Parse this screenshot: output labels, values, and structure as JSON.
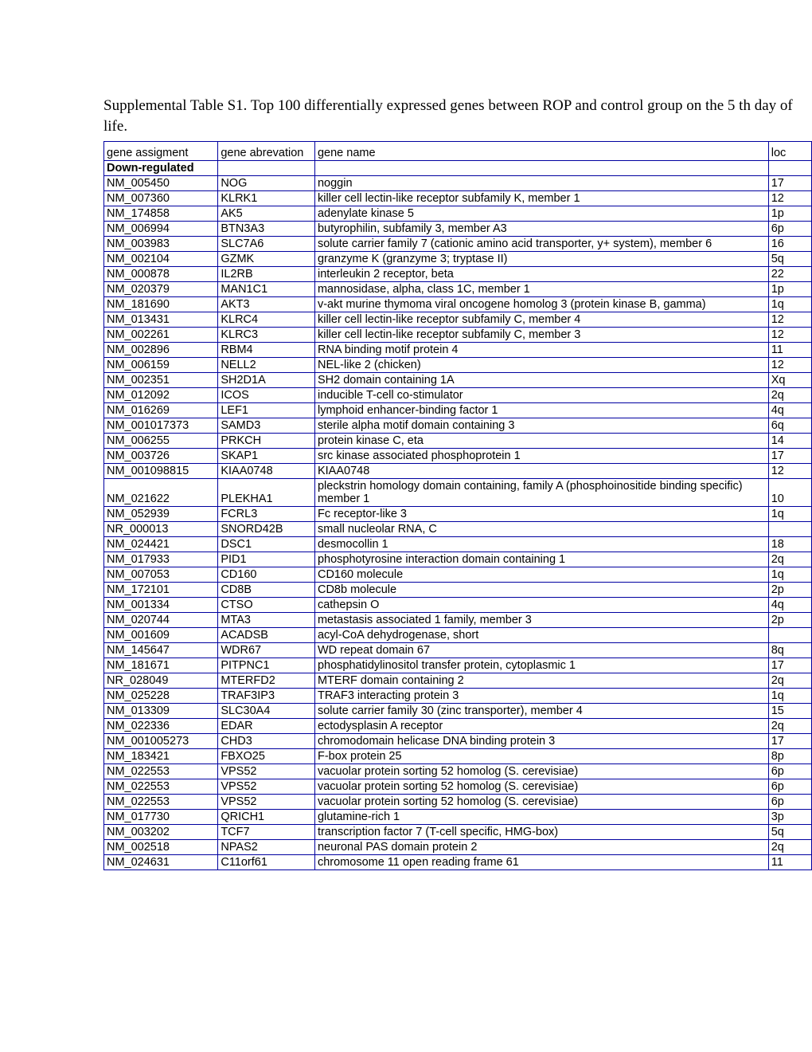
{
  "title": "Supplemental Table S1. Top 100 differentially expressed genes between ROP and control group on the 5 th day of life.",
  "columns": {
    "assign": "gene assigment",
    "abbrev": "gene abrevation",
    "name": "gene name",
    "loc": "loc"
  },
  "section_label": "Down-regulated",
  "chart_data": {
    "type": "table",
    "columns": [
      "gene assigment",
      "gene abrevation",
      "gene name",
      "loc"
    ],
    "rows": [
      [
        "NM_005450",
        "NOG",
        "noggin",
        "17"
      ],
      [
        "NM_007360",
        "KLRK1",
        "killer cell lectin-like receptor subfamily K, member 1",
        "12"
      ],
      [
        "NM_174858",
        "AK5",
        "adenylate kinase 5",
        "1p"
      ],
      [
        "NM_006994",
        "BTN3A3",
        "butyrophilin, subfamily 3, member A3",
        "6p"
      ],
      [
        "NM_003983",
        "SLC7A6",
        "solute carrier family 7 (cationic amino acid transporter, y+ system), member 6",
        "16"
      ],
      [
        "NM_002104",
        "GZMK",
        "granzyme K (granzyme 3; tryptase II)",
        "5q"
      ],
      [
        "NM_000878",
        "IL2RB",
        "interleukin 2 receptor, beta",
        "22"
      ],
      [
        "NM_020379",
        "MAN1C1",
        "mannosidase, alpha, class 1C, member 1",
        "1p"
      ],
      [
        "NM_181690",
        "AKT3",
        "v-akt murine thymoma viral oncogene homolog 3 (protein kinase B, gamma)",
        "1q"
      ],
      [
        "NM_013431",
        "KLRC4",
        "killer cell lectin-like receptor subfamily C, member 4",
        "12"
      ],
      [
        "NM_002261",
        "KLRC3",
        "killer cell lectin-like receptor subfamily C, member 3",
        "12"
      ],
      [
        "NM_002896",
        "RBM4",
        "RNA binding motif protein 4",
        "11"
      ],
      [
        "NM_006159",
        "NELL2",
        "NEL-like 2 (chicken)",
        "12"
      ],
      [
        "NM_002351",
        "SH2D1A",
        "SH2 domain containing 1A",
        "Xq"
      ],
      [
        "NM_012092",
        "ICOS",
        "inducible T-cell co-stimulator",
        "2q"
      ],
      [
        "NM_016269",
        "LEF1",
        "lymphoid enhancer-binding factor 1",
        "4q"
      ],
      [
        "NM_001017373",
        "SAMD3",
        "sterile alpha motif domain containing 3",
        "6q"
      ],
      [
        "NM_006255",
        "PRKCH",
        "protein kinase C, eta",
        "14"
      ],
      [
        "NM_003726",
        "SKAP1",
        "src kinase associated phosphoprotein 1",
        "17"
      ],
      [
        "NM_001098815",
        "KIAA0748",
        "KIAA0748",
        "12"
      ],
      [
        "NM_021622",
        "PLEKHA1",
        "pleckstrin homology domain containing, family A (phosphoinositide binding specific) member 1",
        "10"
      ],
      [
        "NM_052939",
        "FCRL3",
        "Fc receptor-like 3",
        "1q"
      ],
      [
        "NR_000013",
        "SNORD42B",
        "small nucleolar RNA, C",
        ""
      ],
      [
        "NM_024421",
        "DSC1",
        "desmocollin 1",
        "18"
      ],
      [
        "NM_017933",
        "PID1",
        "phosphotyrosine interaction domain containing 1",
        "2q"
      ],
      [
        "NM_007053",
        "CD160",
        "CD160 molecule",
        "1q"
      ],
      [
        "NM_172101",
        "CD8B",
        "CD8b molecule",
        "2p"
      ],
      [
        "NM_001334",
        "CTSO",
        "cathepsin O",
        "4q"
      ],
      [
        "NM_020744",
        "MTA3",
        "metastasis associated 1 family, member 3",
        "2p"
      ],
      [
        "NM_001609",
        "ACADSB",
        "acyl-CoA dehydrogenase, short",
        ""
      ],
      [
        "NM_145647",
        "WDR67",
        "WD repeat domain 67",
        "8q"
      ],
      [
        "NM_181671",
        "PITPNC1",
        "phosphatidylinositol transfer protein, cytoplasmic 1",
        "17"
      ],
      [
        "NR_028049",
        "MTERFD2",
        "MTERF domain containing 2",
        "2q"
      ],
      [
        "NM_025228",
        "TRAF3IP3",
        "TRAF3 interacting protein 3",
        "1q"
      ],
      [
        "NM_013309",
        "SLC30A4",
        "solute carrier family 30 (zinc transporter), member 4",
        "15"
      ],
      [
        "NM_022336",
        "EDAR",
        "ectodysplasin A receptor",
        "2q"
      ],
      [
        "NM_001005273",
        "CHD3",
        "chromodomain helicase DNA binding protein 3",
        "17"
      ],
      [
        "NM_183421",
        "FBXO25",
        "F-box protein 25",
        "8p"
      ],
      [
        "NM_022553",
        "VPS52",
        "vacuolar protein sorting 52 homolog (S. cerevisiae)",
        "6p"
      ],
      [
        "NM_022553",
        "VPS52",
        "vacuolar protein sorting 52 homolog (S. cerevisiae)",
        "6p"
      ],
      [
        "NM_022553",
        "VPS52",
        "vacuolar protein sorting 52 homolog (S. cerevisiae)",
        "6p"
      ],
      [
        "NM_017730",
        "QRICH1",
        "glutamine-rich 1",
        "3p"
      ],
      [
        "NM_003202",
        "TCF7",
        "transcription factor 7 (T-cell specific, HMG-box)",
        "5q"
      ],
      [
        "NM_002518",
        "NPAS2",
        "neuronal PAS domain protein 2",
        "2q"
      ],
      [
        "NM_024631",
        "C11orf61",
        "chromosome 11 open reading frame 61",
        "11"
      ]
    ]
  }
}
